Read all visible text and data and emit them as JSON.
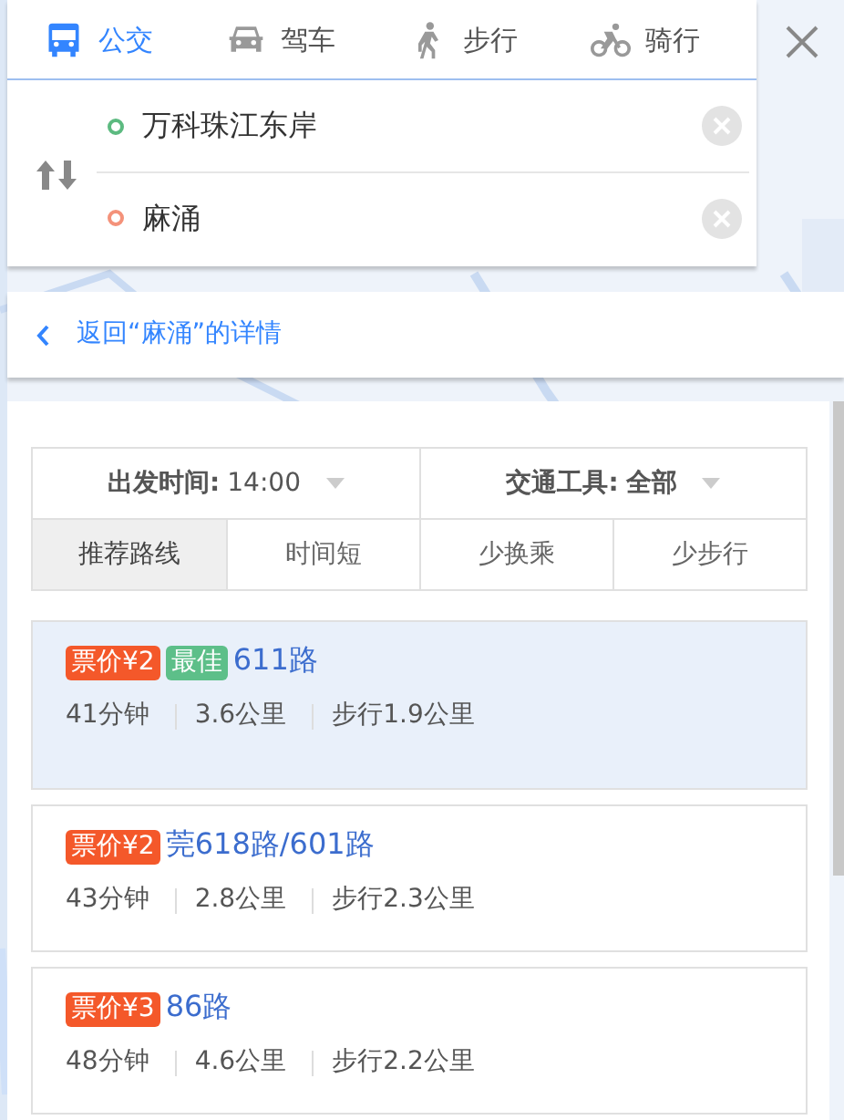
{
  "modes": [
    {
      "kind": "bus",
      "label": "公交",
      "selected": true
    },
    {
      "kind": "car",
      "label": "驾车",
      "selected": false
    },
    {
      "kind": "walk",
      "label": "步行",
      "selected": false
    },
    {
      "kind": "bike",
      "label": "骑行",
      "selected": false
    }
  ],
  "origin": {
    "value": "万科珠江东岸"
  },
  "destination": {
    "value": "麻涌"
  },
  "back_link": "返回“麻涌”的详情",
  "filters": [
    {
      "kind": "time",
      "label": "出发时间:",
      "value": "14:00"
    },
    {
      "kind": "vehicle",
      "label": "交通工具:",
      "value": "全部"
    }
  ],
  "sorts": [
    {
      "label": "推荐路线",
      "selected": true
    },
    {
      "label": "时间短",
      "selected": false
    },
    {
      "label": "少换乘",
      "selected": false
    },
    {
      "label": "少步行",
      "selected": false
    }
  ],
  "routes": [
    {
      "selected": true,
      "tags": [
        {
          "kind": "price",
          "text": "票价¥2"
        },
        {
          "kind": "best",
          "text": "最佳"
        }
      ],
      "name": "611路",
      "stats": [
        "41分钟",
        "3.6公里",
        "步行1.9公里"
      ]
    },
    {
      "selected": false,
      "tags": [
        {
          "kind": "price",
          "text": "票价¥2"
        }
      ],
      "name": "莞618路/601路",
      "stats": [
        "43分钟",
        "2.8公里",
        "步行2.3公里"
      ]
    },
    {
      "selected": false,
      "tags": [
        {
          "kind": "price",
          "text": "票价¥3"
        }
      ],
      "name": "86路",
      "stats": [
        "48分钟",
        "4.6公里",
        "步行2.2公里"
      ]
    }
  ]
}
